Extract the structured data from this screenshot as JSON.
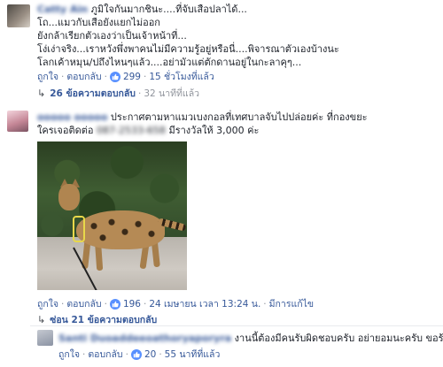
{
  "comment1": {
    "author": "Catty Ain",
    "lines": [
      "ภูมิใจกันมากชินะ....ที่จับเสือปลาได้...",
      "โถ...แมวกับเสือยังแยกไม่ออก",
      "ยังกล้าเรียกตัวเองว่าเป็นเจ้าหน้าที่...",
      "โง่เง่าจริง...เราหวังพึ่งพาคนไม่มีความรู้อยู่หรือนี่....พิจารณาตัวเองบ้างนะ",
      "โลกเค้าหมุน/ปถึงไหนๆแล้ว....อย่ามัวแต่ตักดานอยู่ในกะลาคุๆ..."
    ],
    "like_label": "ถูกใจ",
    "reply_label": "ตอบกลับ",
    "like_count": "299",
    "time": "15 ชั่วโมงที่แล้ว",
    "replies_label": "26 ข้อความตอบกลับ",
    "replies_time": "32 นาทีที่แล้ว"
  },
  "comment2": {
    "author": "ooooo ooooo",
    "line1": "ประกาศตามหาแมวเบงกอลที่เทศบาลจับไปปล่อยค่ะ ที่กองขยะ",
    "line2_prefix": "ใครเจอติดต่อ",
    "phone": "087-2533-658",
    "line2_suffix": "มีรางวัลให้ 3,000 ค่ะ",
    "like_label": "ถูกใจ",
    "reply_label": "ตอบกลับ",
    "like_count": "196",
    "time": "24 เมษายน เวลา 13:24 น.",
    "edited_label": "มีการแก้ไข",
    "hide_replies_label": "ซ่อน 21 ข้อความตอบกลับ"
  },
  "reply1": {
    "author": "Santi Duoaddeeoathoryaporyra",
    "text": "งานนี้ต้องมีคนรับผิดชอบครับ อย่ายอมนะครับ ขอร้อง",
    "like_label": "ถูกใจ",
    "reply_label": "ตอบกลับ",
    "like_count": "20",
    "time": "55 นาทีที่แล้ว"
  },
  "icons": {
    "like": "thumbs-up-icon",
    "reply_arrow": "reply-arrow-icon"
  },
  "colors": {
    "link": "#365899",
    "like_badge": "#5890ff",
    "meta": "#90949c"
  }
}
